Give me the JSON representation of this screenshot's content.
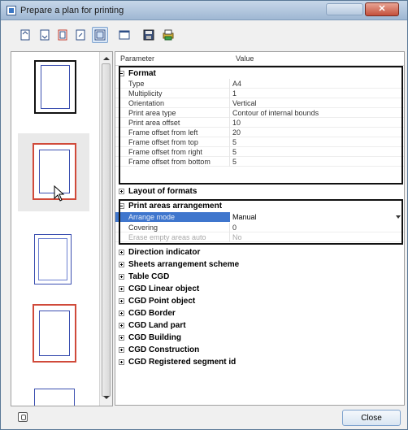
{
  "window": {
    "title": "Prepare a plan for printing"
  },
  "toolbar": {
    "buttons": [
      {
        "name": "rotate-left-icon"
      },
      {
        "name": "rotate-right-icon"
      },
      {
        "name": "page-red-icon"
      },
      {
        "name": "page-frame-icon"
      },
      {
        "name": "active-layout-icon",
        "active": true
      },
      {
        "name": "window-icon"
      },
      {
        "name": "save-icon"
      },
      {
        "name": "print-icon"
      }
    ]
  },
  "grid": {
    "header": {
      "parameter": "Parameter",
      "value": "Value"
    },
    "format": {
      "label": "Format",
      "rows": [
        {
          "k": "Type",
          "v": "A4"
        },
        {
          "k": "Multiplicity",
          "v": "1"
        },
        {
          "k": "Orientation",
          "v": "Vertical"
        },
        {
          "k": "Print area type",
          "v": "Contour of internal bounds"
        },
        {
          "k": "Print area offset",
          "v": "10"
        },
        {
          "k": "Frame offset from left",
          "v": "20"
        },
        {
          "k": "Frame offset from top",
          "v": "5"
        },
        {
          "k": "Frame offset from right",
          "v": "5"
        },
        {
          "k": "Frame offset from bottom",
          "v": "5"
        }
      ]
    },
    "layout_of_formats": "Layout of formats",
    "print_areas": {
      "label": "Print areas arrangement",
      "rows": [
        {
          "k": "Arrange mode",
          "v": "Manual"
        },
        {
          "k": "Covering",
          "v": "0"
        },
        {
          "k": "Erase empty areas auto",
          "v": "No"
        }
      ]
    },
    "collapsed": [
      "Direction indicator",
      "Sheets arrangement scheme",
      "Table CGD",
      "CGD Linear object",
      "CGD Point object",
      "CGD Border",
      "CGD Land part",
      "CGD Building",
      "CGD Construction",
      "CGD Registered segment id"
    ]
  },
  "footer": {
    "close_label": "Close"
  },
  "colors": {
    "highlight": "#3f76cd",
    "frame_red": "#d04a3a",
    "frame_blue": "#3b4fb0"
  }
}
